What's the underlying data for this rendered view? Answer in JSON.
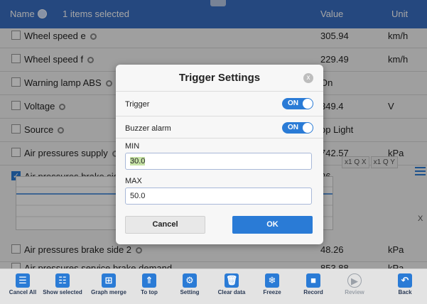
{
  "header": {
    "name": "Name",
    "selected": "1 items selected",
    "value": "Value",
    "unit": "Unit"
  },
  "rows": [
    {
      "label": "Wheel speed e",
      "value": "305.94",
      "unit": "km/h",
      "checked": false
    },
    {
      "label": "Wheel speed f",
      "value": "229.49",
      "unit": "km/h",
      "checked": false
    },
    {
      "label": "Warning lamp ABS",
      "value": "On",
      "unit": "",
      "checked": false
    },
    {
      "label": "Voltage",
      "value": "349.4",
      "unit": "V",
      "checked": false
    },
    {
      "label": "Source",
      "value": "op Light",
      "unit": "",
      "checked": false
    },
    {
      "label": "Air pressures supply",
      "value": "742.57",
      "unit": "kPa",
      "checked": false
    },
    {
      "label": "Air pressures brake side",
      "value": "26",
      "unit": "",
      "checked": true
    },
    {
      "label": "Air pressures brake side 2",
      "value": "48.26",
      "unit": "kPa",
      "checked": false
    },
    {
      "label": "Air pressures service brake demand",
      "value": "853.88",
      "unit": "kPa",
      "checked": false
    }
  ],
  "graph": {
    "zoom_x": "Q X",
    "zoom_y": "Q Y",
    "x1a": "x1",
    "x1b": "x1",
    "close": "X"
  },
  "dialog": {
    "title": "Trigger Settings",
    "close": "x",
    "trigger_label": "Trigger",
    "trigger_state": "ON",
    "buzzer_label": "Buzzer alarm",
    "buzzer_state": "ON",
    "min_label": "MIN",
    "min_value": "30.0",
    "max_label": "MAX",
    "max_value": "50.0",
    "cancel": "Cancel",
    "ok": "OK"
  },
  "toolbar": [
    {
      "label": "Cancel All",
      "icon": "cancel-all-icon",
      "glyph": "☰"
    },
    {
      "label": "Show selected",
      "icon": "show-selected-icon",
      "glyph": "☷"
    },
    {
      "label": "Graph merge",
      "icon": "graph-merge-icon",
      "glyph": "⊞"
    },
    {
      "label": "To top",
      "icon": "to-top-icon",
      "glyph": "⇑"
    },
    {
      "label": "Setting",
      "icon": "gear-icon",
      "glyph": "⚙"
    },
    {
      "label": "Clear data",
      "icon": "trash-icon",
      "glyph": "🗑"
    },
    {
      "label": "Freeze",
      "icon": "snowflake-icon",
      "glyph": "❄"
    },
    {
      "label": "Record",
      "icon": "record-icon",
      "glyph": "■"
    },
    {
      "label": "Review",
      "icon": "play-icon",
      "glyph": "▶"
    },
    {
      "label": "Back",
      "icon": "back-arrow-icon",
      "glyph": "↶"
    }
  ]
}
